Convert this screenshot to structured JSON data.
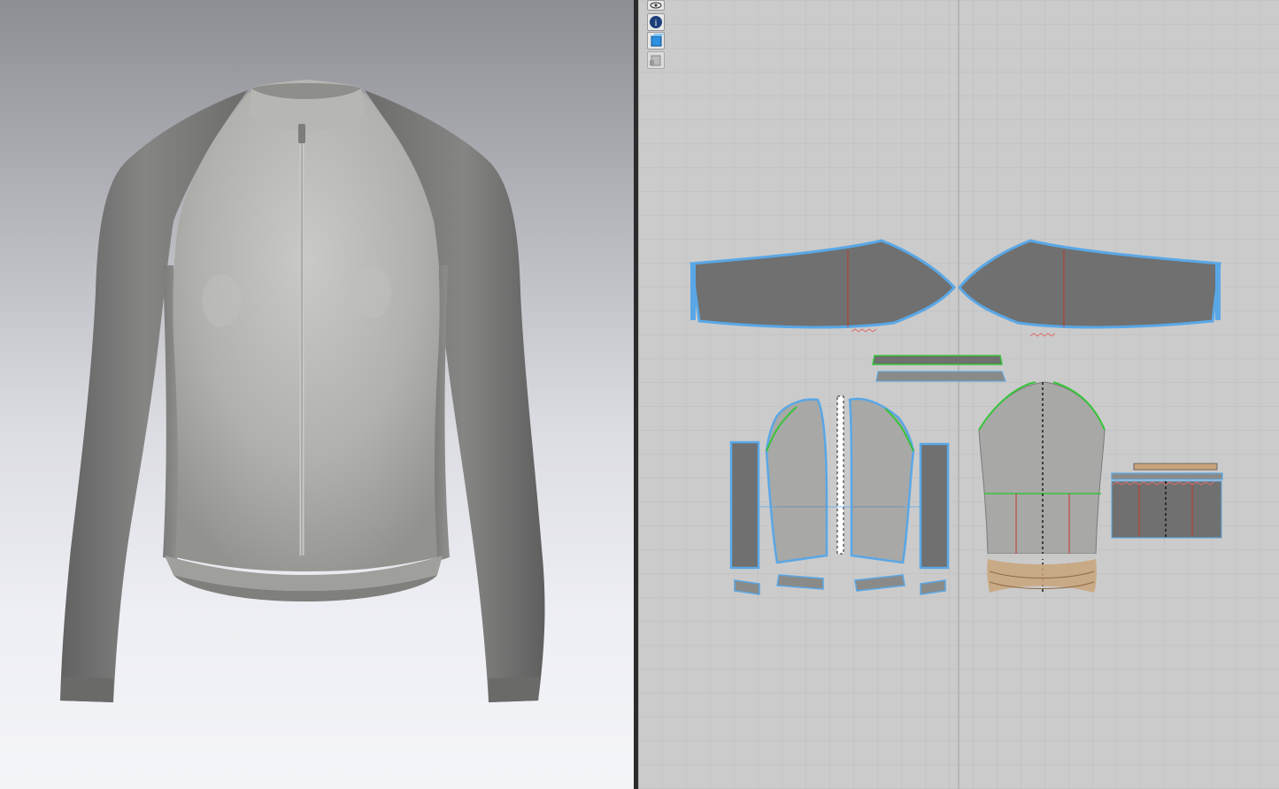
{
  "window": {
    "panels": [
      "3d-view",
      "2d-pattern-view"
    ]
  },
  "toolbar": {
    "tools": [
      {
        "name": "view-options",
        "icon": "eye-icon"
      },
      {
        "name": "info",
        "icon": "info-icon"
      },
      {
        "name": "texture",
        "icon": "texture-icon"
      },
      {
        "name": "pattern-settings",
        "icon": "pattern-icon"
      }
    ]
  },
  "garment": {
    "type": "long-sleeve cycling jersey",
    "colors": {
      "body": "#a9aaa6",
      "sleeve": "#777876",
      "pattern_fill": "#6f706f",
      "pattern_body_fill": "#a8a8a6",
      "seam_outline": "#5aa7e6",
      "seam_green": "#37c43a",
      "seam_red": "#c0392b",
      "binding": "#c9a47a"
    }
  }
}
